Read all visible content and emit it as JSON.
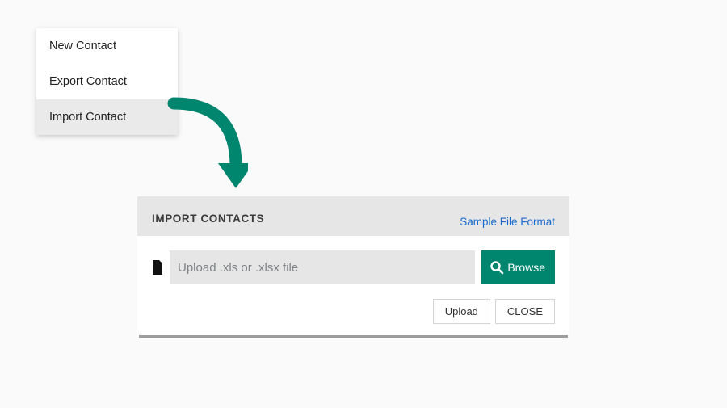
{
  "menu": {
    "items": [
      {
        "label": "New Contact"
      },
      {
        "label": "Export Contact"
      },
      {
        "label": "Import Contact"
      }
    ]
  },
  "dialog": {
    "title": "IMPORT CONTACTS",
    "sample_link": "Sample File Format",
    "file_placeholder": "Upload .xls or .xlsx file",
    "browse_label": "Browse",
    "upload_label": "Upload",
    "close_label": "CLOSE"
  },
  "colors": {
    "accent": "#00856f",
    "link": "#1a6bce"
  }
}
